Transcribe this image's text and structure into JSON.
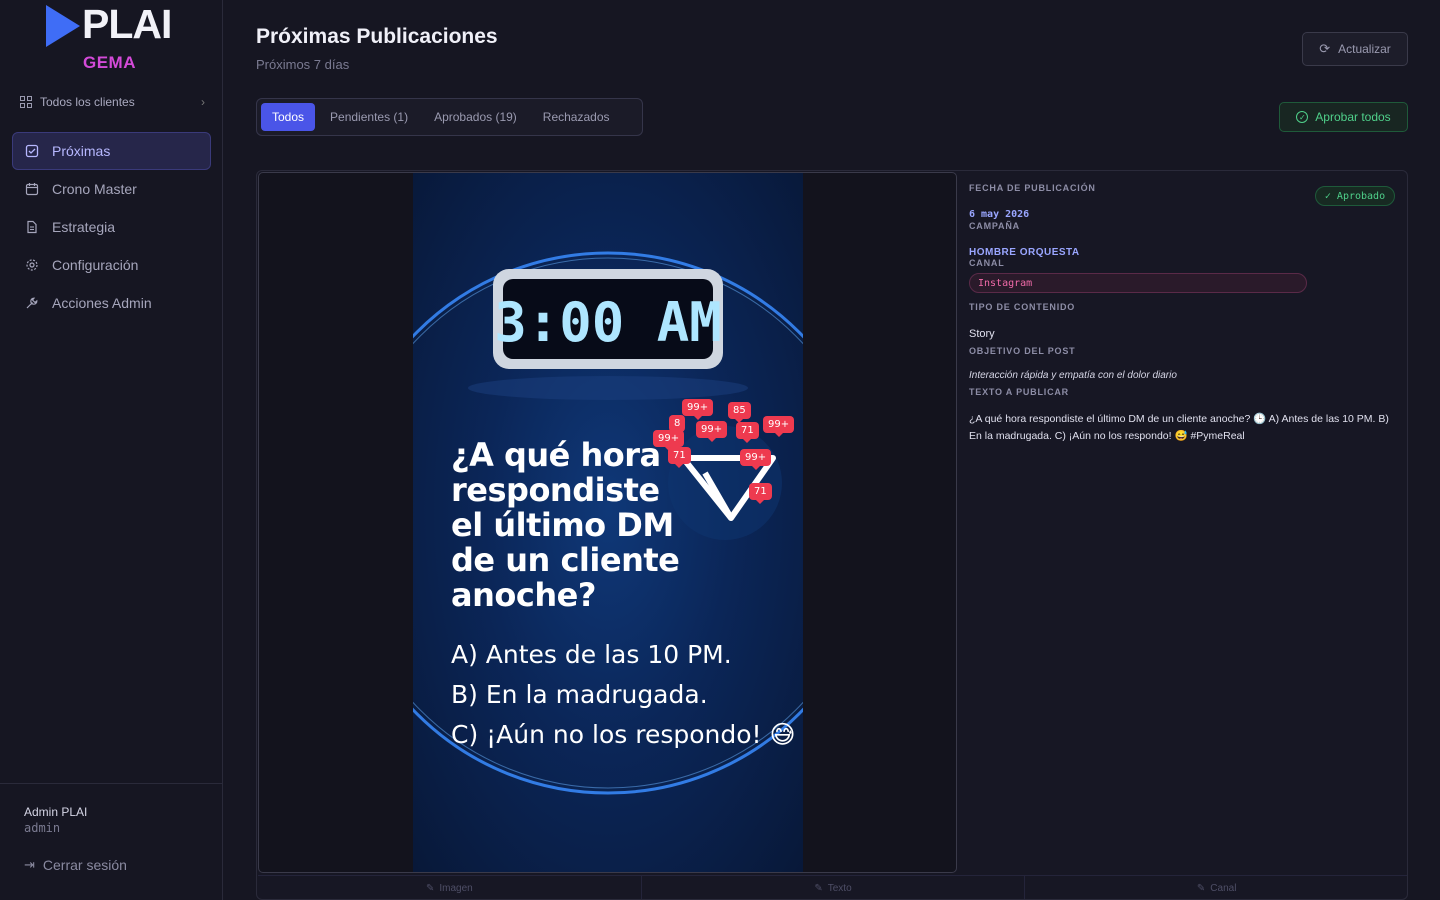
{
  "brand": {
    "name": "PLAI",
    "sub": "GEMA"
  },
  "client_selector": {
    "label": "Todos los clientes"
  },
  "nav": [
    {
      "label": "Próximas",
      "icon": "calendar-check-icon"
    },
    {
      "label": "Crono Master",
      "icon": "calendar-icon"
    },
    {
      "label": "Estrategia",
      "icon": "document-icon"
    },
    {
      "label": "Configuración",
      "icon": "gear-icon"
    },
    {
      "label": "Acciones Admin",
      "icon": "wrench-icon"
    }
  ],
  "user": {
    "name": "Admin PLAI",
    "role": "admin"
  },
  "logout_label": "Cerrar sesión",
  "page": {
    "title": "Próximas Publicaciones",
    "subtitle": "Próximos 7 días"
  },
  "refresh_label": "Actualizar",
  "tabs": [
    {
      "label": "Todos",
      "active": true
    },
    {
      "label": "Pendientes (1)",
      "active": false
    },
    {
      "label": "Aprobados (19)",
      "active": false
    },
    {
      "label": "Rechazados",
      "active": false
    }
  ],
  "approve_all_label": "Aprobar todos",
  "post": {
    "story": {
      "clock": "3:00 AM",
      "question": "¿A qué hora respondiste el último DM de un cliente anoche?",
      "options": [
        "A) Antes de las 10 PM.",
        "B) En la madrugada.",
        "C) ¡Aún no los respondo! 😅"
      ],
      "badges": [
        "99+",
        "85",
        "8",
        "99+",
        "71",
        "99+",
        "99+",
        "71",
        "99+",
        "71"
      ]
    },
    "details": {
      "date_label": "FECHA DE PUBLICACIÓN",
      "date": "6 may 2026",
      "status": "✓ Aprobado",
      "campaign_label": "CAMPAÑA",
      "campaign": "HOMBRE ORQUESTA",
      "channel_label": "CANAL",
      "channel": "Instagram",
      "type_label": "TIPO DE CONTENIDO",
      "type": "Story",
      "objective_label": "OBJETIVO DEL POST",
      "objective": "Interacción rápida y empatía con el dolor diario",
      "text_label": "TEXTO A PUBLICAR",
      "text": "¿A qué hora respondiste el último DM de un cliente anoche? 🕒 A) Antes de las 10 PM. B) En la madrugada. C) ¡Aún no los respondo! 😅 #PymeReal"
    },
    "footer": [
      "Imagen",
      "Texto",
      "Canal"
    ]
  },
  "colors": {
    "accent": "#4a55e8",
    "approved": "#4fd08a",
    "brand_blue": "#3f6df6",
    "brand_pink": "#d34ad8",
    "badge": "#ee3a4f"
  }
}
